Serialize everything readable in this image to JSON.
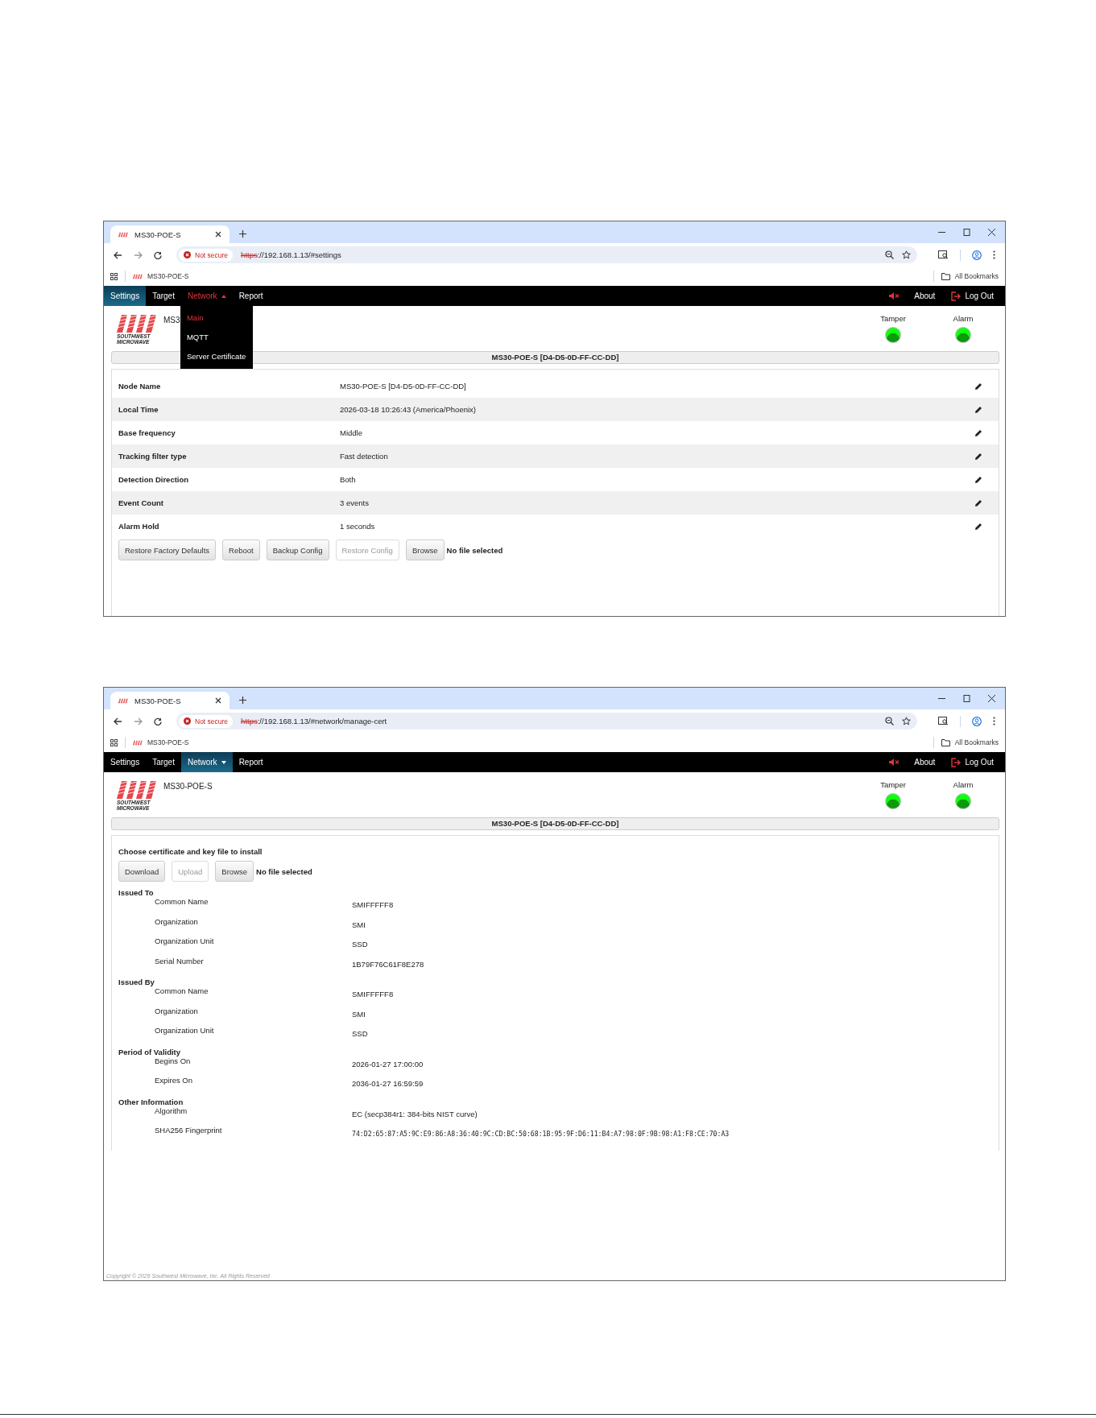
{
  "screenshots": [
    {
      "tab_title": "MS30-POE-S",
      "security": "Not secure",
      "url_scheme": "https",
      "url_rest": "://192.168.1.13/#settings",
      "bookmark": "MS30-POE-S",
      "all_bookmarks": "All Bookmarks",
      "nav": [
        {
          "label": "Settings",
          "selected": true,
          "open": false,
          "dropdown": false
        },
        {
          "label": "Target",
          "selected": false,
          "open": false,
          "dropdown": false
        },
        {
          "label": "Network",
          "selected": false,
          "open": true,
          "dropdown": true
        },
        {
          "label": "Report",
          "selected": false,
          "open": false,
          "dropdown": false
        }
      ],
      "menu": [
        {
          "label": "Main",
          "selected": true
        },
        {
          "label": "MQTT",
          "selected": false
        },
        {
          "label": "Server Certificate",
          "selected": false
        }
      ],
      "about": "About",
      "logout": "Log Out",
      "device_name": "MS3",
      "logo_text": [
        "SOUTHWEST",
        "MICROWAVE"
      ],
      "indicators": [
        {
          "label": "Tamper",
          "on": true
        },
        {
          "label": "Alarm",
          "on": true
        }
      ],
      "title_bar": "MS30-POE-S [D4-D5-0D-FF-CC-DD]",
      "content": {
        "kind": "settings",
        "rows": [
          {
            "label": "Node Name",
            "value": "MS30-POE-S [D4-D5-0D-FF-CC-DD]"
          },
          {
            "label": "Local Time",
            "value": "2026-03-18 10:26:43 (America/Phoenix)"
          },
          {
            "label": "Base frequency",
            "value": "Middle"
          },
          {
            "label": "Tracking filter type",
            "value": "Fast detection"
          },
          {
            "label": "Detection Direction",
            "value": "Both"
          },
          {
            "label": "Event Count",
            "value": "3 events"
          },
          {
            "label": "Alarm Hold",
            "value": "1 seconds"
          }
        ],
        "buttons": [
          {
            "label": "Restore Factory Defaults",
            "disabled": false
          },
          {
            "label": "Reboot",
            "disabled": false
          },
          {
            "label": "Backup Config",
            "disabled": false
          },
          {
            "label": "Restore Config",
            "disabled": true
          },
          {
            "label": "Browse",
            "disabled": false
          }
        ],
        "file_status": "No file selected"
      }
    },
    {
      "tab_title": "MS30-POE-S",
      "security": "Not secure",
      "url_scheme": "https",
      "url_rest": "://192.168.1.13/#network/manage-cert",
      "bookmark": "MS30-POE-S",
      "all_bookmarks": "All Bookmarks",
      "nav": [
        {
          "label": "Settings",
          "selected": false,
          "open": false,
          "dropdown": false
        },
        {
          "label": "Target",
          "selected": false,
          "open": false,
          "dropdown": false
        },
        {
          "label": "Network",
          "selected": true,
          "open": false,
          "dropdown": true
        },
        {
          "label": "Report",
          "selected": false,
          "open": false,
          "dropdown": false
        }
      ],
      "about": "About",
      "logout": "Log Out",
      "device_name": "MS30-POE-S",
      "logo_text": [
        "SOUTHWEST",
        "MICROWAVE"
      ],
      "indicators": [
        {
          "label": "Tamper",
          "on": true
        },
        {
          "label": "Alarm",
          "on": true
        }
      ],
      "title_bar": "MS30-POE-S [D4-D5-0D-FF-CC-DD]",
      "content": {
        "kind": "certificate",
        "heading": "Choose certificate and key file to install",
        "buttons": [
          {
            "label": "Download",
            "disabled": false
          },
          {
            "label": "Upload",
            "disabled": true
          },
          {
            "label": "Browse",
            "disabled": false
          }
        ],
        "file_status": "No file selected",
        "sections": [
          {
            "title": "Issued To",
            "fields": [
              {
                "label": "Common Name",
                "value": "SMIFFFFF8"
              },
              {
                "label": "Organization",
                "value": "SMI"
              },
              {
                "label": "Organization Unit",
                "value": "SSD"
              },
              {
                "label": "Serial Number",
                "value": "1B79F76C61F8E278"
              }
            ]
          },
          {
            "title": "Issued By",
            "fields": [
              {
                "label": "Common Name",
                "value": "SMIFFFFF8"
              },
              {
                "label": "Organization",
                "value": "SMI"
              },
              {
                "label": "Organization Unit",
                "value": "SSD"
              }
            ]
          },
          {
            "title": "Period of Validity",
            "fields": [
              {
                "label": "Begins On",
                "value": "2026-01-27 17:00:00"
              },
              {
                "label": "Expires On",
                "value": "2036-01-27 16:59:59"
              }
            ]
          },
          {
            "title": "Other Information",
            "fields": [
              {
                "label": "Algorithm",
                "value": "EC (secp384r1: 384-bits NIST curve)"
              },
              {
                "label": "SHA256 Fingerprint",
                "value": "74:D2:65:87:A5:9C:E9:86:A8:36:40:9C:CD:BC:50:68:1B:95:9F:D6:11:B4:A7:98:0F:9B:98:A1:F8:CE:70:A3",
                "kind": "mono"
              }
            ]
          }
        ]
      },
      "footer": "Copyright © 2026 Southwest Microwave, Inc. All Rights Reserved"
    }
  ]
}
